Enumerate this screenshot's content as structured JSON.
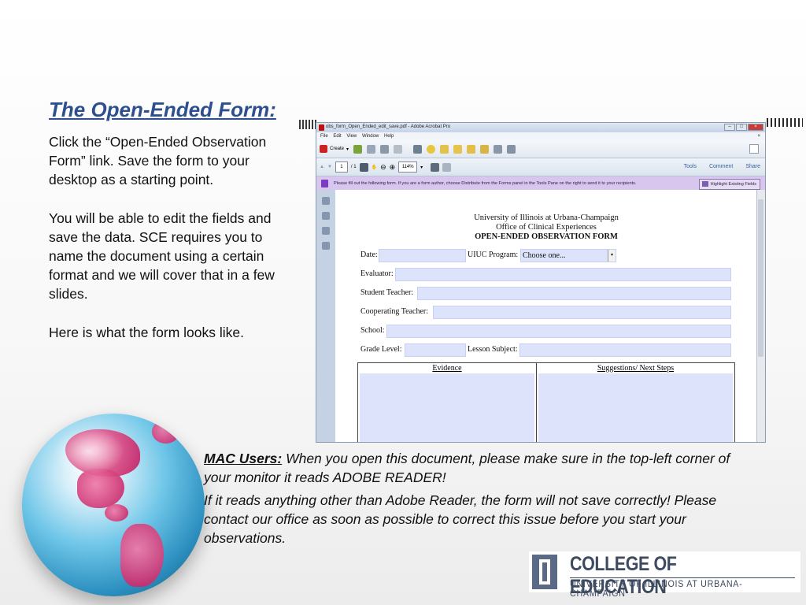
{
  "slide": {
    "title": "The Open-Ended Form:",
    "paragraphs": [
      "Click the “Open-Ended Observation Form” link. Save the form to your desktop as a starting point.",
      "You will be able to edit the fields and save the data. SCE requires you to name the document using a certain format and we will cover that in a few slides.",
      "Here is what the form looks like."
    ],
    "mac_label": "MAC Users:",
    "mac_line": " When you open this document, please make sure in the top-left corner of your monitor it reads ADOBE READER!",
    "mac_line2": "If it reads anything other than Adobe Reader, the form will not save correctly! Please contact our office as soon as possible to correct this issue before you start your observations."
  },
  "acrobat": {
    "window_title": "obs_form_Open_Ended_edit_save.pdf - Adobe Acrobat Pro",
    "menu": [
      "File",
      "Edit",
      "View",
      "Window",
      "Help"
    ],
    "menu_close": "×",
    "create_label": "Create",
    "page_current": "1",
    "page_total": "/ 1",
    "zoom": "114%",
    "right_links": [
      "Tools",
      "Comment",
      "Share"
    ],
    "notice_text": "Please fill out the following form. If you are a form author, choose Distribute from the Forms panel in the Tools Pane on the right to send it to your recipients.",
    "highlight_button": "Highlight Existing Fields",
    "icons": [
      "pdf-icon",
      "create-icon",
      "open-icon",
      "save-icon",
      "print-icon",
      "email-icon",
      "comment-icon",
      "page-icon",
      "text-icon",
      "hand-icon",
      "zoom-out-icon",
      "zoom-in-icon"
    ]
  },
  "form": {
    "org1": "University of Illinois at Urbana-Champaign",
    "org2": "Office of Clinical Experiences",
    "form_title": "OPEN-ENDED OBSERVATION FORM",
    "date_label": "Date:",
    "program_label": "UIUC Program:",
    "program_value": "Choose one...",
    "evaluator_label": "Evaluator:",
    "student_teacher_label": "Student Teacher:",
    "cooperating_teacher_label": "Cooperating Teacher:",
    "school_label": "School:",
    "grade_label": "Grade Level:",
    "lesson_label": "Lesson Subject:",
    "evidence_header": "Evidence",
    "suggestions_header": "Suggestions/ Next Steps"
  },
  "logo": {
    "line1": "COLLEGE OF EDUCATION",
    "line2": "UNIVERSITY OF ILLINOIS AT URBANA-CHAMPAIGN"
  },
  "colors": {
    "title_blue": "#2d4f8f",
    "field_fill": "#dce3fb",
    "notice_purple": "#d8c6ef",
    "logo_gray": "#3d4a5f"
  }
}
